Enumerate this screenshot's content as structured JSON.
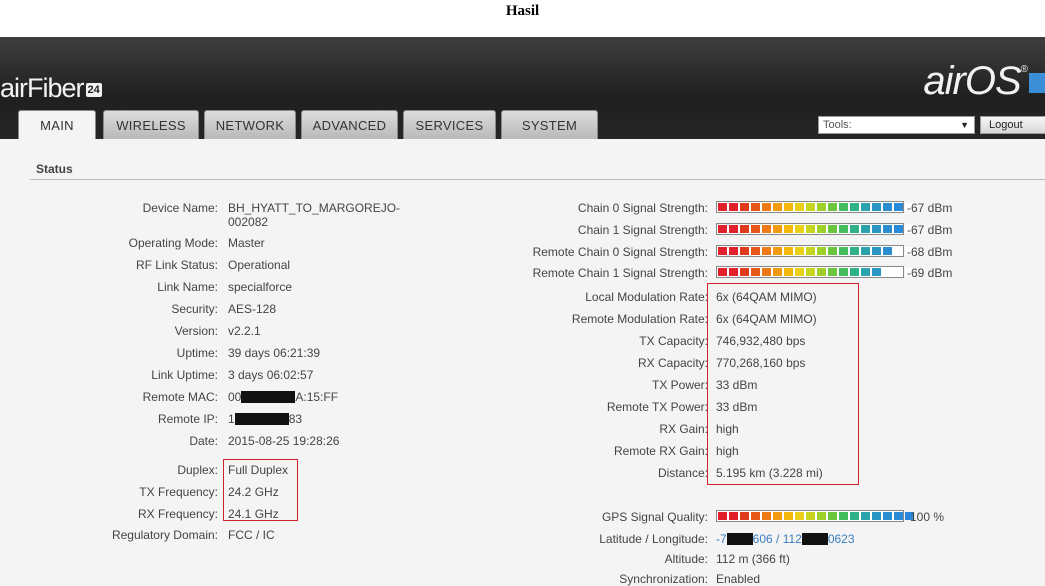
{
  "caption": "Hasil",
  "header": {
    "logo_left": "airFiber",
    "logo_left_badge": "24",
    "logo_right": "airOS",
    "logo_right_mark": "®"
  },
  "tabs": [
    {
      "label": "MAIN",
      "active": true
    },
    {
      "label": "WIRELESS",
      "active": false
    },
    {
      "label": "NETWORK",
      "active": false
    },
    {
      "label": "ADVANCED",
      "active": false
    },
    {
      "label": "SERVICES",
      "active": false
    },
    {
      "label": "SYSTEM",
      "active": false
    }
  ],
  "tools": {
    "label": "Tools:",
    "arrow": "▼"
  },
  "logout": {
    "label": "Logout"
  },
  "section_title": "Status",
  "left": {
    "device_name": {
      "label": "Device Name:",
      "value": "BH_HYATT_TO_MARGOREJO-",
      "value2": "002082"
    },
    "operating_mode": {
      "label": "Operating Mode:",
      "value": "Master"
    },
    "rf_link_status": {
      "label": "RF Link Status:",
      "value": "Operational"
    },
    "link_name": {
      "label": "Link Name:",
      "value": "specialforce"
    },
    "security": {
      "label": "Security:",
      "value": "AES-128"
    },
    "version": {
      "label": "Version:",
      "value": "v2.2.1"
    },
    "uptime": {
      "label": "Uptime:",
      "value": "39 days 06:21:39"
    },
    "link_uptime": {
      "label": "Link Uptime:",
      "value": "3 days 06:02:57"
    },
    "remote_mac": {
      "label": "Remote MAC:",
      "prefix": "00",
      "suffix": "A:15:FF"
    },
    "remote_ip": {
      "label": "Remote IP:",
      "prefix": "1",
      "suffix": "83"
    },
    "date": {
      "label": "Date:",
      "value": "2015-08-25 19:28:26"
    },
    "duplex": {
      "label": "Duplex:",
      "value": "Full Duplex"
    },
    "tx_frequency": {
      "label": "TX Frequency:",
      "value": "24.2 GHz"
    },
    "rx_frequency": {
      "label": "RX Frequency:",
      "value": "24.1 GHz"
    },
    "regulatory_domain": {
      "label": "Regulatory Domain:",
      "value": "FCC / IC"
    }
  },
  "right": {
    "chain0": {
      "label": "Chain 0 Signal Strength:",
      "value": "-67 dBm",
      "level": 0.93
    },
    "chain1": {
      "label": "Chain 1 Signal Strength:",
      "value": "-67 dBm",
      "level": 0.93
    },
    "remote_chain0": {
      "label": "Remote Chain 0 Signal Strength:",
      "value": "-68 dBm",
      "level": 0.88
    },
    "remote_chain1": {
      "label": "Remote Chain 1 Signal Strength:",
      "value": "-69 dBm",
      "level": 0.83
    },
    "local_mod_rate": {
      "label": "Local Modulation Rate:",
      "value": "6x (64QAM MIMO)"
    },
    "remote_mod_rate": {
      "label": "Remote Modulation Rate:",
      "value": "6x (64QAM MIMO)"
    },
    "tx_capacity": {
      "label": "TX Capacity:",
      "value": "746,932,480 bps"
    },
    "rx_capacity": {
      "label": "RX Capacity:",
      "value": "770,268,160 bps"
    },
    "tx_power": {
      "label": "TX Power:",
      "value": "33 dBm"
    },
    "remote_tx_power": {
      "label": "Remote TX Power:",
      "value": "33 dBm"
    },
    "rx_gain": {
      "label": "RX Gain:",
      "value": "high"
    },
    "remote_rx_gain": {
      "label": "Remote RX Gain:",
      "value": "high"
    },
    "distance": {
      "label": "Distance:",
      "value": "5.195 km (3.228 mi)"
    },
    "gps_quality": {
      "label": "GPS Signal Quality:",
      "value": "100 %",
      "level": 1.0
    },
    "lat_lon": {
      "label": "Latitude / Longitude:",
      "prefix": "-7",
      "mid": "606 / 112",
      "suffix": "0623"
    },
    "altitude": {
      "label": "Altitude:",
      "value": "112 m (366 ft)"
    },
    "synchronization": {
      "label": "Synchronization:",
      "value": "Enabled"
    }
  },
  "colors": {
    "highlight_box": "#d0202a",
    "link": "#3a7fc1",
    "header_bg": "#262626"
  }
}
